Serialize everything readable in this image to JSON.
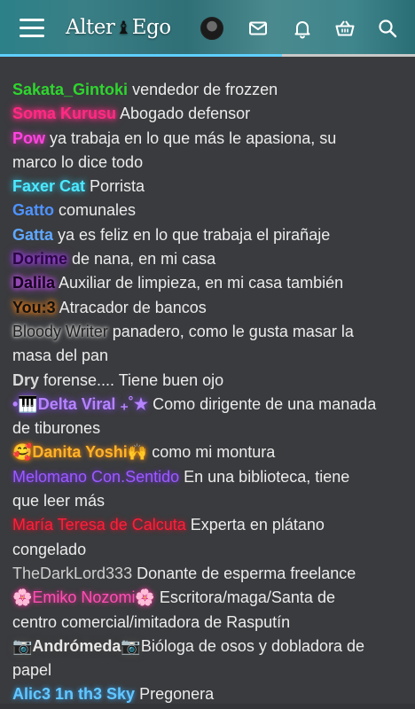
{
  "header": {
    "logo_left": "Alter",
    "logo_piece": "♝",
    "logo_right": "Ego",
    "icons": [
      "menu-icon",
      "profile-avatar",
      "mail-icon",
      "bell-icon",
      "basket-icon",
      "search-icon"
    ],
    "accent_color": "#5fd0ff",
    "bar_color": "#2f7a82"
  },
  "chat": {
    "messages": [
      {
        "name": "Sakata_Gintoki",
        "text": " vendedor de frozzen"
      },
      {
        "name": "Soma Kurusu",
        "text": " Abogado defensor"
      },
      {
        "name": "Pow",
        "text": " ya trabaja en lo que más le apasiona, su"
      },
      {
        "name": "",
        "text": "marco lo dice todo"
      },
      {
        "name": "Faxer Cat",
        "text": " Porrista"
      },
      {
        "name": "Gatto",
        "text": " comunales"
      },
      {
        "name": "Gatta",
        "text": " ya es feliz en lo que trabaja el pirañaje"
      },
      {
        "name": "Dorime",
        "text": " de nana, en mi casa"
      },
      {
        "name": "Dalila",
        "text": " Auxiliar de limpieza, en mi casa también"
      },
      {
        "name": "You:3",
        "text": " Atracador de bancos"
      },
      {
        "name": "Bloody Writer",
        "text": " panadero, como le gusta masar la"
      },
      {
        "name": "",
        "text": "masa del pan"
      },
      {
        "name": "Dry",
        "text": " forense.... Tiene buen ojo"
      },
      {
        "name": "•🎹Delta Viral ₊˚★",
        "text": " Como dirigente de una manada"
      },
      {
        "name": "",
        "text": "de tiburones"
      },
      {
        "name": "🥰Danita Yoshi🙌",
        "text": " como mi montura"
      },
      {
        "name": "Melomano Con.Sentido",
        "text": " En una biblioteca, tiene"
      },
      {
        "name": "",
        "text": "que leer más"
      },
      {
        "name": "María Teresa de Calcuta",
        "text": " Experta en plátano"
      },
      {
        "name": "",
        "text": "congelado"
      },
      {
        "name": "TheDarkLord333",
        "text": " Donante de esperma freelance"
      },
      {
        "name": "🌸Emiko Nozomi🌸",
        "text": " Escritora/maga/Santa de"
      },
      {
        "name": "",
        "text": "centro comercial/imitadora de Rasputín"
      },
      {
        "name": "📷Andrómeda📷",
        "text": "Bióloga de osos y dobladora de"
      },
      {
        "name": "",
        "text": "papel"
      },
      {
        "name": "Alic3 1n th3 Sky",
        "text": " Pregonera"
      }
    ]
  }
}
